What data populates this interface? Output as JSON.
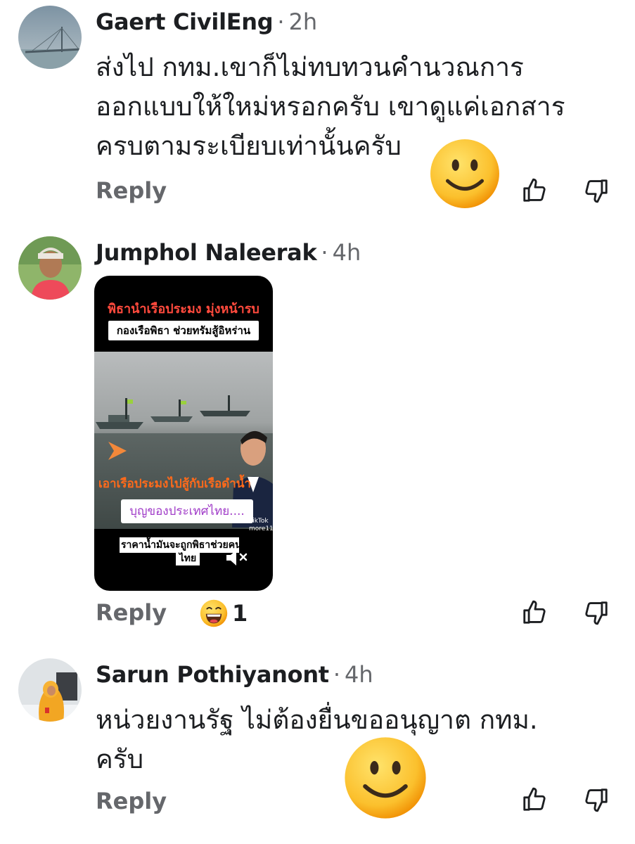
{
  "comments": [
    {
      "author": "Gaert CivilEng",
      "separator": "·",
      "time": "2h",
      "text_lines": [
        "ส่งไป กทม.เขาก็ไม่ทบทวนคำนวณการ",
        "ออกแบบให้ใหม่หรอกครับ เขาดูแค่เอกสาร",
        "ครบตามระเบียบเท่านั้นครับ"
      ],
      "reply_label": "Reply"
    },
    {
      "author": "Jumphol Naleerak",
      "separator": "·",
      "time": "4h",
      "video": {
        "title": "พิธานำเรือประมง มุ่งหน้ารบ",
        "subtitle": "กองเรือพิธา ช่วยทรัมสู้อิหร่าน",
        "caption": "เอาเรือประมงไปสู้กับเรือดำน้ำ",
        "sticker": "บุญของประเทศไทย....",
        "price_line1": "ราคาน้ำมันจะถูกพิธาช่วยคน",
        "price_line2": "ไทย",
        "tiktok_label": "TikTok",
        "tiktok_handle": "more11"
      },
      "reply_label": "Reply",
      "reaction_count": "1"
    },
    {
      "author": "Sarun Pothiyanont",
      "separator": "·",
      "time": "4h",
      "text_lines": [
        "หน่วยงานรัฐ ไม่ต้องยื่นขออนุญาต กทม.",
        "ครับ"
      ],
      "reply_label": "Reply"
    }
  ],
  "colors": {
    "text": "#1c1e21",
    "meta": "#65676b",
    "emoji": "#fbc02d"
  },
  "icons": [
    "thumbs-up-icon",
    "thumbs-down-icon",
    "smiley-emoji-icon",
    "grinning-emoji-icon",
    "mute-icon"
  ]
}
